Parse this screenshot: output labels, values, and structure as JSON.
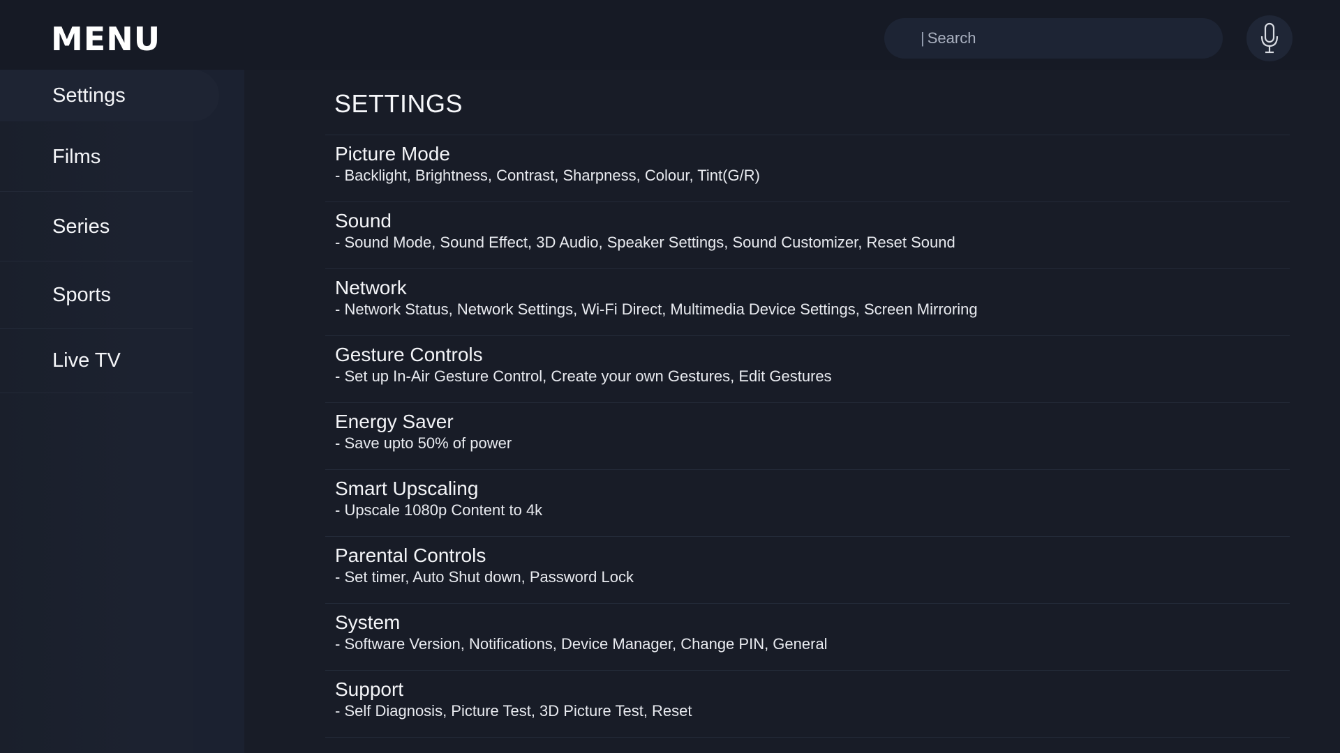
{
  "header": {
    "logo": "MENU",
    "search_placeholder": "Search",
    "search_caret": "|"
  },
  "sidebar": {
    "items": [
      {
        "label": "Settings",
        "active": true
      },
      {
        "label": "Films",
        "active": false
      },
      {
        "label": "Series",
        "active": false
      },
      {
        "label": "Sports",
        "active": false
      },
      {
        "label": "Live TV",
        "active": false
      }
    ]
  },
  "main": {
    "title": "SETTINGS",
    "settings": [
      {
        "title": "Picture Mode",
        "desc": "- Backlight, Brightness, Contrast, Sharpness, Colour, Tint(G/R)"
      },
      {
        "title": "Sound",
        "desc": "- Sound Mode, Sound Effect, 3D Audio, Speaker Settings, Sound Customizer, Reset Sound"
      },
      {
        "title": "Network",
        "desc": "- Network Status, Network Settings, Wi-Fi Direct, Multimedia Device Settings, Screen Mirroring"
      },
      {
        "title": "Gesture Controls",
        "desc": "- Set up In-Air Gesture Control, Create your own Gestures, Edit Gestures"
      },
      {
        "title": "Energy Saver",
        "desc": "- Save upto 50% of power"
      },
      {
        "title": "Smart Upscaling",
        "desc": "- Upscale 1080p Content to 4k"
      },
      {
        "title": "Parental Controls",
        "desc": "- Set timer, Auto Shut down, Password Lock"
      },
      {
        "title": "System",
        "desc": "- Software Version, Notifications, Device Manager, Change PIN, General"
      },
      {
        "title": "Support",
        "desc": "- Self Diagnosis, Picture Test, 3D Picture Test, Reset"
      }
    ]
  },
  "icons": {
    "mic": "microphone-icon"
  },
  "colors": {
    "background": "#181c27",
    "topbar": "#161a25",
    "search_bg": "#1d2434",
    "text": "#f4f5f8"
  }
}
